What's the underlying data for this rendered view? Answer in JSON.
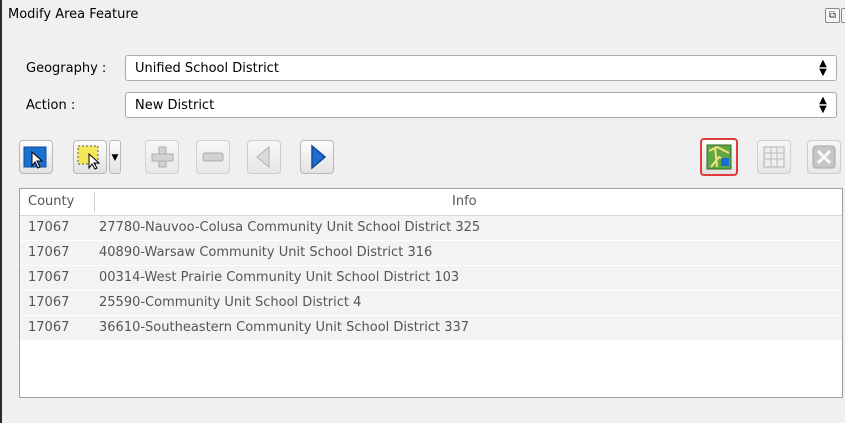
{
  "window": {
    "title": "Modify Area Feature"
  },
  "form": {
    "geography_label": "Geography :",
    "geography_value": "Unified School District",
    "action_label": "Action :",
    "action_value": "New District"
  },
  "toolbar": {
    "icons": [
      "select-pointer-icon",
      "rectangle-select-icon",
      "dropdown-arrow-icon",
      "add-icon",
      "remove-icon",
      "previous-icon",
      "next-icon",
      "map-view-icon",
      "table-view-icon",
      "close-icon"
    ],
    "highlight_color": "#e03a3a",
    "accent_color": "#1a6fd0"
  },
  "table": {
    "columns": [
      "County",
      "Info"
    ],
    "rows": [
      {
        "county": "17067",
        "info": "27780-Nauvoo-Colusa Community Unit School District 325"
      },
      {
        "county": "17067",
        "info": "40890-Warsaw Community Unit School District 316"
      },
      {
        "county": "17067",
        "info": "00314-West Prairie Community Unit School District 103"
      },
      {
        "county": "17067",
        "info": "25590-Community Unit School District 4"
      },
      {
        "county": "17067",
        "info": "36610-Southeastern Community Unit School District 337"
      }
    ]
  }
}
